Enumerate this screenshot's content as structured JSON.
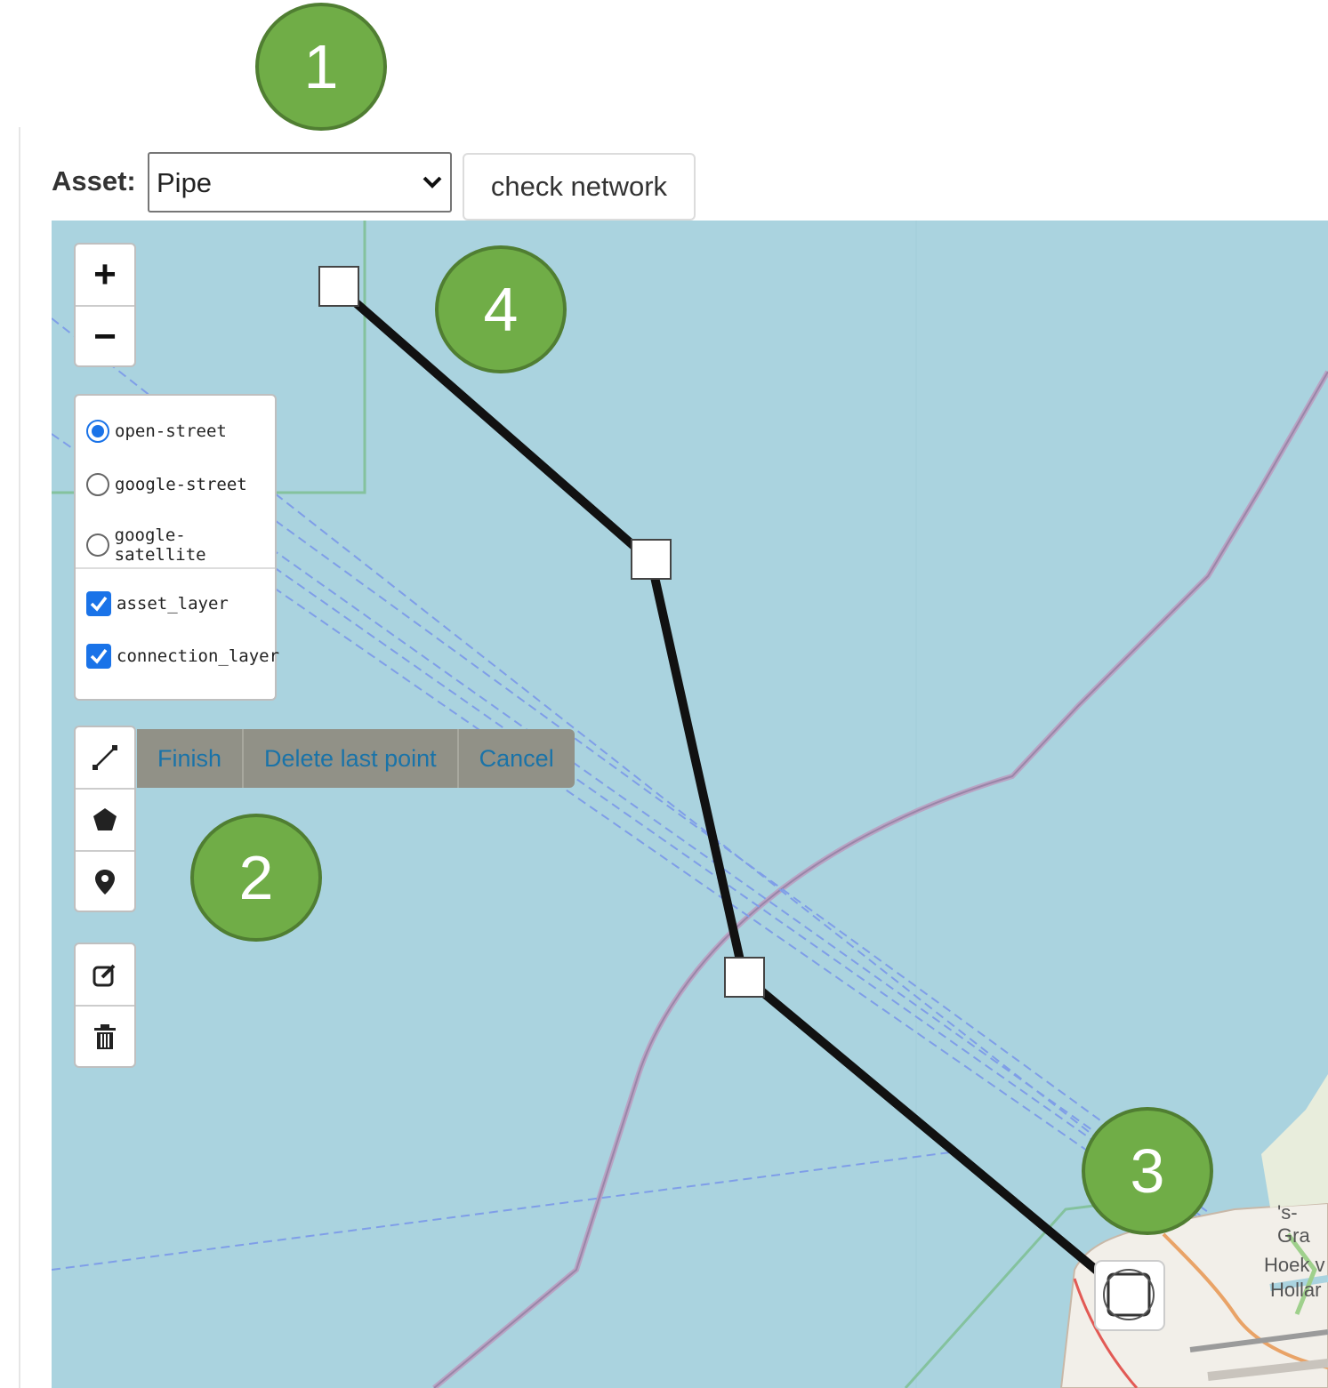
{
  "toolbar": {
    "asset_label": "Asset:",
    "asset_value": "Pipe",
    "check_button": "check network"
  },
  "map": {
    "zoom_in": "+",
    "zoom_out": "−",
    "base_layers": [
      {
        "label": "open-street",
        "selected": true
      },
      {
        "label": "google-street",
        "selected": false
      },
      {
        "label": "google-satellite",
        "selected": false
      }
    ],
    "overlays": [
      {
        "label": "asset_layer",
        "checked": true
      },
      {
        "label": "connection_layer",
        "checked": true
      }
    ],
    "draw_tools": [
      "polyline-icon",
      "polygon-icon",
      "marker-icon"
    ],
    "edit_tools": [
      "edit-icon",
      "trash-icon"
    ],
    "draw_actions": [
      "Finish",
      "Delete last point",
      "Cancel"
    ],
    "place_labels": [
      "'s-Gra",
      "Hoek v",
      "Hollar"
    ]
  },
  "callouts": [
    "1",
    "2",
    "3",
    "4"
  ],
  "colors": {
    "water": "#aad3df",
    "callout": "#70ad47",
    "pipe": "#111111",
    "accent": "#1a73e8"
  }
}
